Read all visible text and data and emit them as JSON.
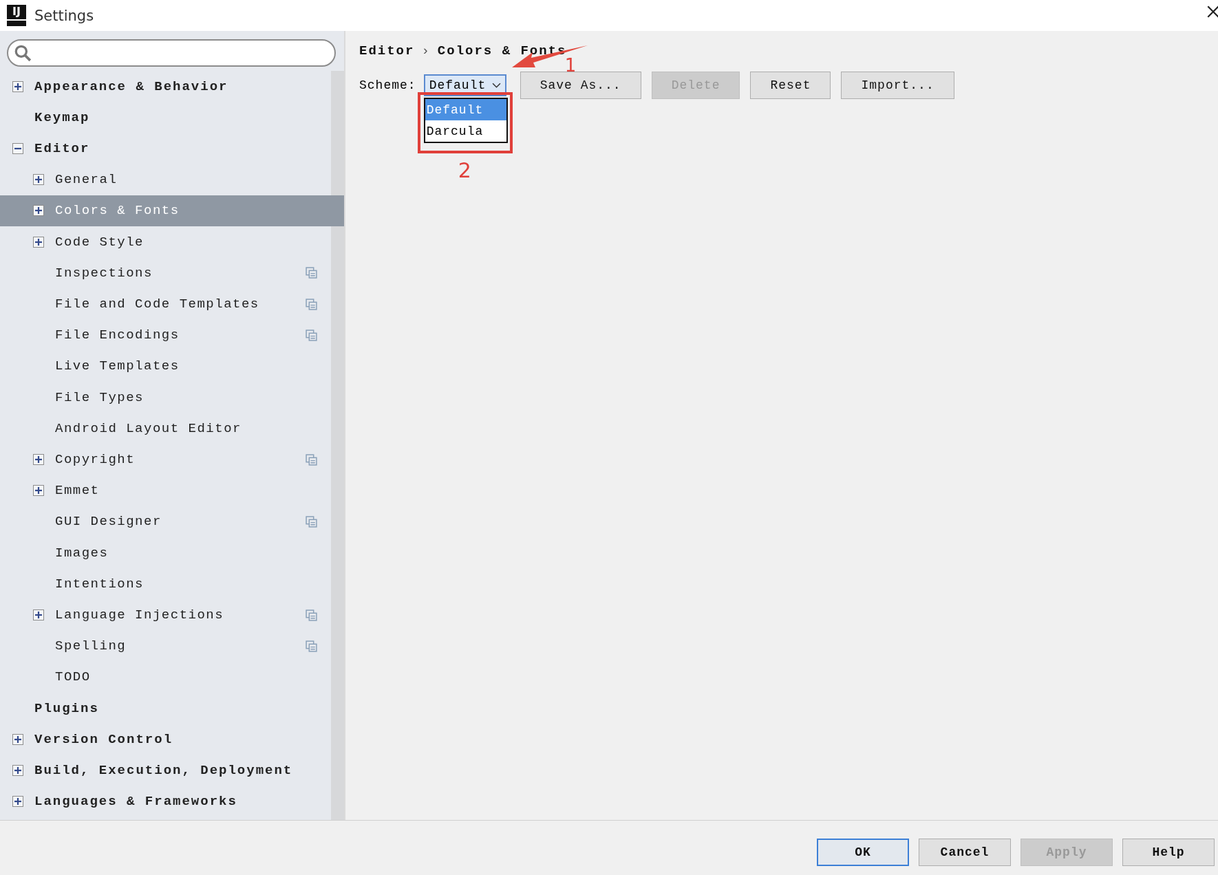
{
  "window": {
    "logo_text": "IJ",
    "title": "Settings"
  },
  "tree": [
    {
      "label": "Appearance & Behavior",
      "expanded": false,
      "selected": false
    },
    {
      "label": "Keymap",
      "selected": false
    },
    {
      "label": "Editor",
      "expanded": true,
      "selected": false,
      "children": [
        {
          "label": "General",
          "expanded": false,
          "selected": false
        },
        {
          "label": "Colors & Fonts",
          "expanded": false,
          "selected": true
        },
        {
          "label": "Code Style",
          "expanded": false,
          "selected": false
        },
        {
          "label": "Inspections",
          "selected": false,
          "per_project": true
        },
        {
          "label": "File and Code Templates",
          "selected": false,
          "per_project": true
        },
        {
          "label": "File Encodings",
          "selected": false,
          "per_project": true
        },
        {
          "label": "Live Templates",
          "selected": false
        },
        {
          "label": "File Types",
          "selected": false
        },
        {
          "label": "Android Layout Editor",
          "selected": false
        },
        {
          "label": "Copyright",
          "expanded": false,
          "selected": false,
          "per_project": true
        },
        {
          "label": "Emmet",
          "expanded": false,
          "selected": false
        },
        {
          "label": "GUI Designer",
          "selected": false,
          "per_project": true
        },
        {
          "label": "Images",
          "selected": false
        },
        {
          "label": "Intentions",
          "selected": false
        },
        {
          "label": "Language Injections",
          "expanded": false,
          "selected": false,
          "per_project": true
        },
        {
          "label": "Spelling",
          "selected": false,
          "per_project": true
        },
        {
          "label": "TODO",
          "selected": false
        }
      ]
    },
    {
      "label": "Plugins",
      "selected": false
    },
    {
      "label": "Version Control",
      "expanded": false,
      "selected": false
    },
    {
      "label": "Build, Execution, Deployment",
      "expanded": false,
      "selected": false
    },
    {
      "label": "Languages & Frameworks",
      "expanded": false,
      "selected": false
    }
  ],
  "breadcrumb": {
    "separator": "›",
    "items": [
      "Editor",
      "Colors & Fonts"
    ]
  },
  "scheme": {
    "label": "Scheme:",
    "value": "Default",
    "open": true,
    "options": [
      {
        "label": "Default",
        "selected": true
      },
      {
        "label": "Darcula",
        "selected": false
      }
    ]
  },
  "scheme_buttons": [
    {
      "label": "Save As...",
      "disabled": false
    },
    {
      "label": "Delete",
      "disabled": true
    },
    {
      "label": "Reset",
      "disabled": false
    },
    {
      "label": "Import...",
      "disabled": false
    }
  ],
  "annotations": [
    {
      "kind": "arrow",
      "label": "1"
    },
    {
      "kind": "box",
      "label": "2"
    }
  ],
  "dialog_buttons": [
    {
      "label": "OK",
      "disabled": false,
      "default": true
    },
    {
      "label": "Cancel",
      "disabled": false,
      "default": false
    },
    {
      "label": "Apply",
      "disabled": true,
      "default": false
    },
    {
      "label": "Help",
      "disabled": false,
      "default": false
    }
  ]
}
